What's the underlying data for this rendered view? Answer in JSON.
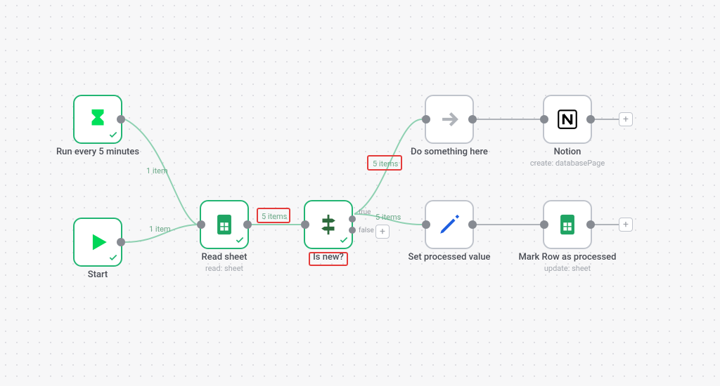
{
  "nodes": {
    "timer": {
      "title": "Run every 5 minutes",
      "sub": ""
    },
    "start": {
      "title": "Start",
      "sub": ""
    },
    "read": {
      "title": "Read sheet",
      "sub": "read: sheet"
    },
    "isnew": {
      "title": "Is new?",
      "sub": ""
    },
    "do": {
      "title": "Do something here",
      "sub": ""
    },
    "notion": {
      "title": "Notion",
      "sub": "create: databasePage"
    },
    "set": {
      "title": "Set processed value",
      "sub": ""
    },
    "mark": {
      "title": "Mark Row as processed",
      "sub": "update: sheet"
    }
  },
  "labels": {
    "oneItemA": "1 item",
    "oneItemB": "1 item",
    "fiveItemsA": "5 items",
    "fiveItemsB": "5 items",
    "fiveItemsC": "5 items",
    "true": "true",
    "false": "false",
    "plus": "+"
  }
}
